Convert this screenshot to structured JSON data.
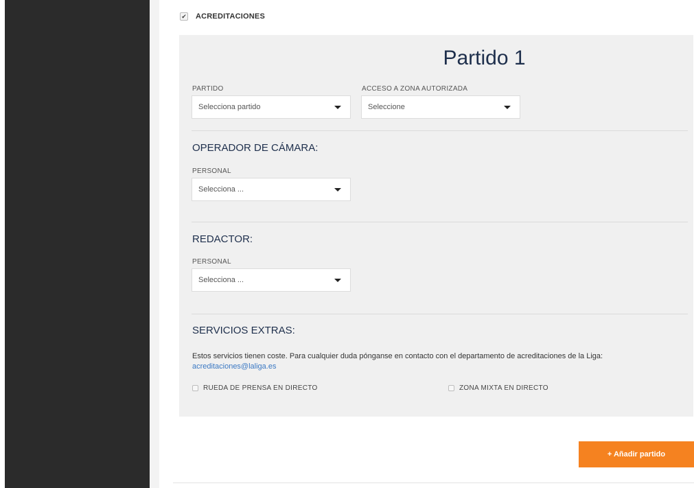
{
  "section": {
    "checkbox_mark": "✔",
    "title": "ACREDITACIONES"
  },
  "match": {
    "title": "Partido 1",
    "partido_label": "PARTIDO",
    "partido_value": "Selecciona partido",
    "zona_label": "ACCESO A ZONA AUTORIZADA",
    "zona_value": "Seleccione"
  },
  "camera": {
    "heading": "OPERADOR DE CÁMARA:",
    "personal_label": "PERSONAL",
    "personal_value": "Selecciona ..."
  },
  "redactor": {
    "heading": "REDACTOR:",
    "personal_label": "PERSONAL",
    "personal_value": "Selecciona ..."
  },
  "extras": {
    "heading": "SERVICIOS EXTRAS:",
    "info_text": "Estos servicios tienen coste. Para cualquier duda pónganse en contacto con el departamento de acreditaciones de la Liga:",
    "email": "acreditaciones@laliga.es",
    "option_1": "RUEDA DE PRENSA EN DIRECTO",
    "option_2": "ZONA MIXTA EN DIRECTO"
  },
  "actions": {
    "add_match": "+ Añadir partido"
  },
  "colors": {
    "sidebar": "#2b2b2b",
    "panel": "#f0f0f0",
    "accent": "#f58220",
    "heading": "#1e2f4c",
    "link": "#3a78c3"
  }
}
